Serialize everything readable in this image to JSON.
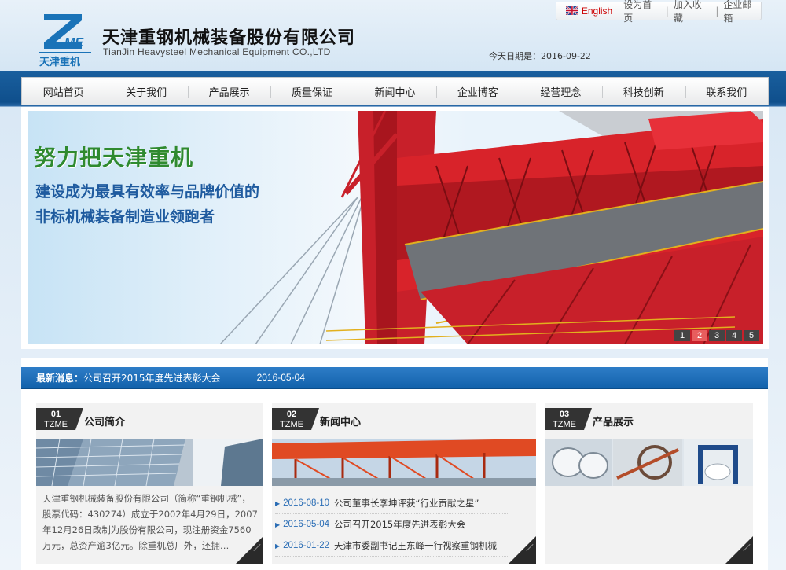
{
  "header": {
    "logo_text": "天津重机",
    "logo_letters": "ME",
    "company_cn": "天津重钢机械装备股份有限公司",
    "company_en": "TianJin Heavysteel Mechanical Equipment CO.,LTD",
    "today_label": "今天日期是：2016-09-22"
  },
  "top_links": {
    "english": "English",
    "set_home": "设为首页",
    "favorite": "加入收藏",
    "mail": "企业邮箱",
    "sep": "|"
  },
  "nav": {
    "items": [
      "网站首页",
      "关于我们",
      "产品展示",
      "质量保证",
      "新闻中心",
      "企业博客",
      "经营理念",
      "科技创新",
      "联系我们"
    ]
  },
  "banner": {
    "slogan_1": "努力把天津重机",
    "slogan_2": "建设成为最具有效率与品牌价值的",
    "slogan_3": "非标机械装备制造业领跑者",
    "pages": [
      "1",
      "2",
      "3",
      "4",
      "5"
    ],
    "active_page": 2
  },
  "latest_news": {
    "label": "最新消息：",
    "title": "公司召开2015年度先进表彰大会",
    "date": "2016-05-04"
  },
  "columns": {
    "about": {
      "num": "01",
      "code": "TZME",
      "title": "公司简介",
      "text": "天津重钢机械装备股份有限公司（简称“重钢机械”，股票代码：430274）成立于2002年4月29日，2007年12月26日改制为股份有限公司，现注册资金7560万元，总资产逾3亿元。除重机总厂外，还拥…"
    },
    "news": {
      "num": "02",
      "code": "TZME",
      "title": "新闻中心",
      "items": [
        {
          "date": "2016-08-10",
          "title": "公司董事长李坤评获“行业贡献之星”"
        },
        {
          "date": "2016-05-04",
          "title": "公司召开2015年度先进表彰大会"
        },
        {
          "date": "2016-01-22",
          "title": "天津市委副书记王东峰一行视察重钢机械"
        }
      ]
    },
    "products": {
      "num": "03",
      "code": "TZME",
      "title": "产品展示"
    }
  },
  "colors": {
    "nav_blue": "#1363ac",
    "slogan_green": "#2f8a2f",
    "slogan_blue": "#1f5b9f",
    "crane_red": "#d8232a",
    "pager_active": "#e85d5d"
  }
}
